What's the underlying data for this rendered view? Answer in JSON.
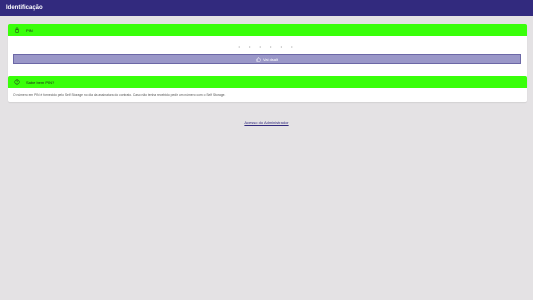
{
  "header": {
    "title": "Identificação"
  },
  "pin_card": {
    "title": "PIN",
    "icon": "lock-icon",
    "pin_dots": "• • • • • •",
    "login_button": {
      "label": "Vai dsalt",
      "icon": "thumbs-up-icon"
    }
  },
  "help_card": {
    "title": "Sabe bem PIN?",
    "icon": "question-circle-icon",
    "text": "O número em PIN é fornecido pelo Self Storage no dia da assinatura do contrato. Caso não tenha recebido pedir um número com o Self Storage."
  },
  "footer": {
    "admin_link": "Acesso do Administrador"
  },
  "colors": {
    "topbar": "#322a7e",
    "card_header": "#39ff0a",
    "button": "#9a97c8",
    "background": "#e4e2e4"
  }
}
